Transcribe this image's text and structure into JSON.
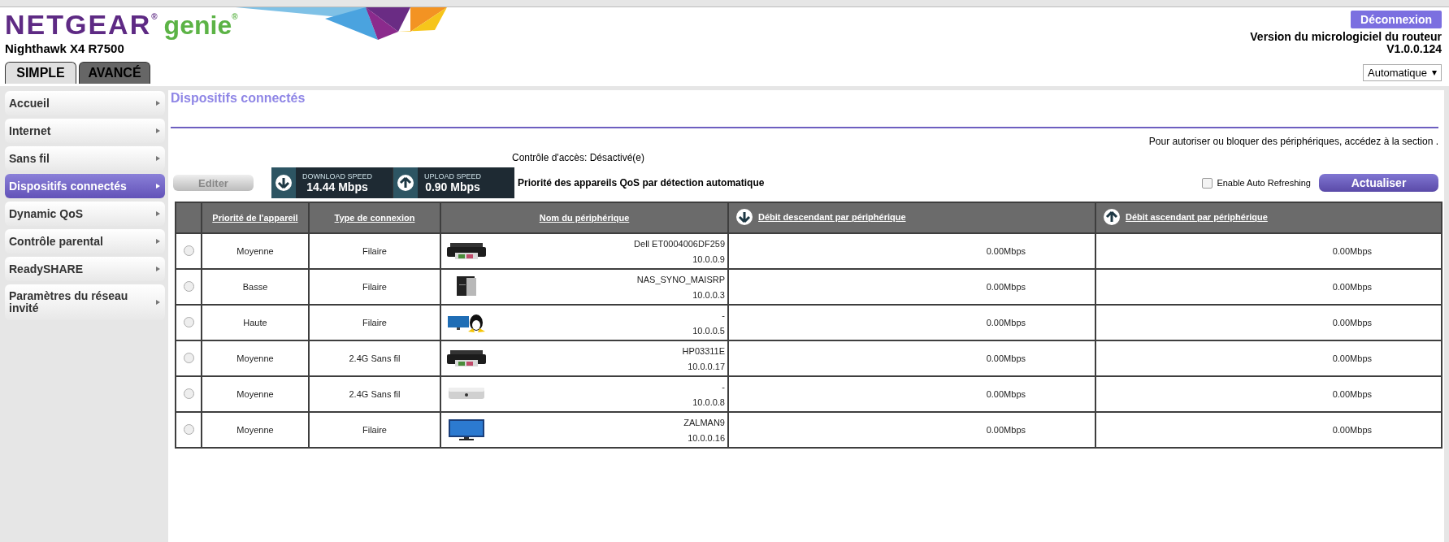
{
  "header": {
    "brand": "NETGEAR$^{®}$",
    "product": "genie$^{®}$",
    "model": "Nighthawk X4 R7500",
    "logout": "Déconnexion",
    "firmware_label": "Version du micrologiciel du routeur",
    "firmware_version": "V1.0.0.124",
    "language": "Automatique"
  },
  "tabs": [
    {
      "label": "SIMPLE",
      "selected": true
    },
    {
      "label": "AVANCÉ",
      "selected": false
    }
  ],
  "sidebar": {
    "items": [
      {
        "label": "Accueil",
        "selected": false
      },
      {
        "label": "Internet",
        "selected": false
      },
      {
        "label": "Sans fil",
        "selected": false
      },
      {
        "label": "Dispositifs connectés",
        "selected": true
      },
      {
        "label": "Dynamic QoS",
        "selected": false
      },
      {
        "label": "Contrôle parental",
        "selected": false
      },
      {
        "label": "ReadySHARE",
        "selected": false
      },
      {
        "label": "Paramètres du réseau invité",
        "selected": false
      }
    ]
  },
  "content": {
    "title": "Dispositifs connectés",
    "access_hint": "Pour autoriser ou bloquer des périphériques, accédez à la section .",
    "access_control": "Contrôle d'accès: Désactivé(e)",
    "edit_button": "Editer",
    "speed": {
      "download_label": "DOWNLOAD SPEED",
      "download_value": "14.44 Mbps",
      "upload_label": "UPLOAD SPEED",
      "upload_value": "0.90 Mbps"
    },
    "qos_note": "Priorité des appareils QoS par détection automatique",
    "auto_refresh": {
      "label": "Enable Auto Refreshing",
      "checked": false
    },
    "refresh_button": "Actualiser",
    "table": {
      "columns": [
        {
          "label": "Priorité de l'appareil",
          "kind": "plain"
        },
        {
          "label": "Type de connexion",
          "kind": "plain"
        },
        {
          "label": "Nom du périphérique",
          "kind": "plain"
        },
        {
          "label": "Débit descendant par périphérique",
          "kind": "down"
        },
        {
          "label": "Débit ascendant par périphérique",
          "kind": "up"
        }
      ],
      "rows": [
        {
          "selected": false,
          "priority": "Moyenne",
          "connection": "Filaire",
          "kind": "printer",
          "name": "Dell ET0004006DF259",
          "ip": "10.0.0.9",
          "down": "0.00Mbps",
          "up": "0.00Mbps"
        },
        {
          "selected": false,
          "priority": "Basse",
          "connection": "Filaire",
          "kind": "nas",
          "name": "NAS_SYNO_MAISRP",
          "ip": "10.0.0.3",
          "down": "0.00Mbps",
          "up": "0.00Mbps"
        },
        {
          "selected": false,
          "priority": "Haute",
          "connection": "Filaire",
          "kind": "linux",
          "name": "-",
          "ip": "10.0.0.5",
          "down": "0.00Mbps",
          "up": "0.00Mbps"
        },
        {
          "selected": false,
          "priority": "Moyenne",
          "connection": "2.4G Sans fil",
          "kind": "printer",
          "name": "HP03311E",
          "ip": "10.0.0.17",
          "down": "0.00Mbps",
          "up": "0.00Mbps"
        },
        {
          "selected": false,
          "priority": "Moyenne",
          "connection": "2.4G Sans fil",
          "kind": "unknown",
          "name": "-",
          "ip": "10.0.0.8",
          "down": "0.00Mbps",
          "up": "0.00Mbps"
        },
        {
          "selected": false,
          "priority": "Moyenne",
          "connection": "Filaire",
          "kind": "monitor",
          "name": "ZALMAN9",
          "ip": "10.0.0.16",
          "down": "0.00Mbps",
          "up": "0.00Mbps"
        }
      ]
    }
  }
}
